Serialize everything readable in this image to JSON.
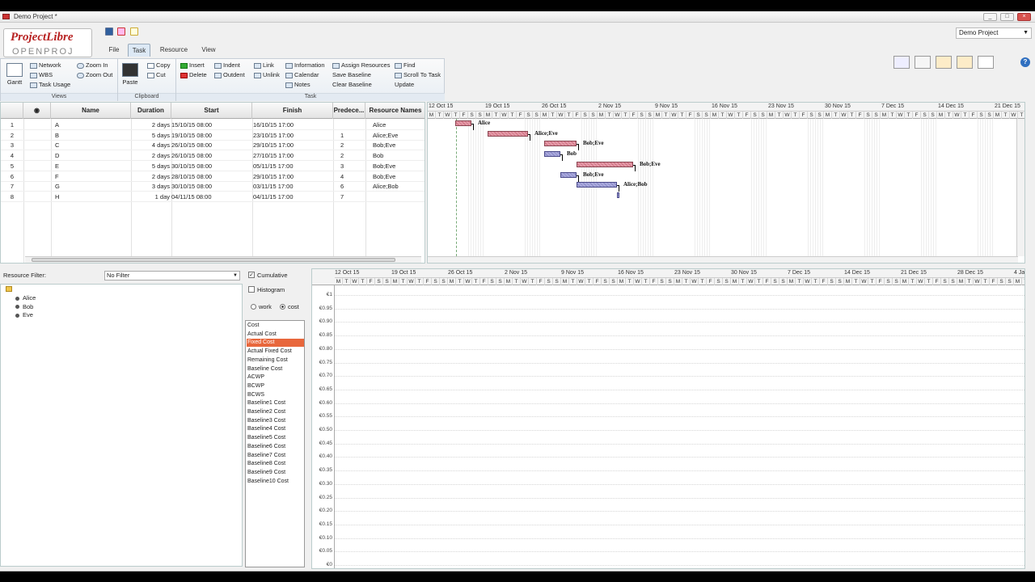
{
  "window": {
    "title": "Demo Project *"
  },
  "logo": {
    "line1": "ProjectLibre",
    "line2": "OPENPROJ"
  },
  "menu_tabs": [
    "File",
    "Task",
    "Resource",
    "View"
  ],
  "project_selector": {
    "value": "Demo Project"
  },
  "ribbon": {
    "views": {
      "label": "Views",
      "gantt": "Gantt",
      "network": "Network",
      "wbs": "WBS",
      "task_usage": "Task Usage",
      "zoom_in": "Zoom In",
      "zoom_out": "Zoom Out"
    },
    "clipboard": {
      "label": "Clipboard",
      "paste": "Paste",
      "copy": "Copy",
      "cut": "Cut"
    },
    "task": {
      "label": "Task",
      "insert": "Insert",
      "delete": "Delete",
      "indent": "Indent",
      "outdent": "Outdent",
      "link": "Link",
      "unlink": "Unlink",
      "information": "Information",
      "calendar": "Calendar",
      "notes": "Notes",
      "assign_resources": "Assign Resources",
      "save_baseline": "Save Baseline",
      "clear_baseline": "Clear Baseline",
      "find": "Find",
      "scroll_to_task": "Scroll To Task",
      "update": "Update"
    }
  },
  "task_table": {
    "headers": {
      "name": "Name",
      "duration": "Duration",
      "start": "Start",
      "finish": "Finish",
      "predecessors": "Predece...",
      "resource_names": "Resource Names"
    },
    "rows": [
      {
        "id": "1",
        "name": "A",
        "duration": "2 days",
        "start": "15/10/15 08:00",
        "finish": "16/10/15 17:00",
        "pred": "",
        "res": "Alice"
      },
      {
        "id": "2",
        "name": "B",
        "duration": "5 days",
        "start": "19/10/15 08:00",
        "finish": "23/10/15 17:00",
        "pred": "1",
        "res": "Alice;Eve"
      },
      {
        "id": "3",
        "name": "C",
        "duration": "4 days",
        "start": "26/10/15 08:00",
        "finish": "29/10/15 17:00",
        "pred": "2",
        "res": "Bob;Eve"
      },
      {
        "id": "4",
        "name": "D",
        "duration": "2 days",
        "start": "26/10/15 08:00",
        "finish": "27/10/15 17:00",
        "pred": "2",
        "res": "Bob"
      },
      {
        "id": "5",
        "name": "E",
        "duration": "5 days",
        "start": "30/10/15 08:00",
        "finish": "05/11/15 17:00",
        "pred": "3",
        "res": "Bob;Eve"
      },
      {
        "id": "6",
        "name": "F",
        "duration": "2 days",
        "start": "28/10/15 08:00",
        "finish": "29/10/15 17:00",
        "pred": "4",
        "res": "Bob;Eve"
      },
      {
        "id": "7",
        "name": "G",
        "duration": "3 days",
        "start": "30/10/15 08:00",
        "finish": "03/11/15 17:00",
        "pred": "6",
        "res": "Alice;Bob"
      },
      {
        "id": "8",
        "name": "H",
        "duration": "1 day",
        "start": "04/11/15 08:00",
        "finish": "04/11/15 17:00",
        "pred": "7",
        "res": ""
      }
    ]
  },
  "gantt": {
    "weeks": [
      "12 Oct 15",
      "19 Oct 15",
      "26 Oct 15",
      "2 Nov 15",
      "9 Nov 15",
      "16 Nov 15",
      "23 Nov 15",
      "30 Nov 15",
      "7 Dec 15",
      "14 Dec 15",
      "21 Dec 15"
    ],
    "day_letters": [
      "M",
      "T",
      "W",
      "T",
      "F",
      "S",
      "S"
    ],
    "bars": [
      {
        "task": "A",
        "start_day": 3,
        "dur": 2,
        "label": "Alice",
        "color": "red",
        "row": 0
      },
      {
        "task": "B",
        "start_day": 7,
        "dur": 5,
        "label": "Alice;Eve",
        "color": "red",
        "row": 1
      },
      {
        "task": "C",
        "start_day": 14,
        "dur": 4,
        "label": "Bob;Eve",
        "color": "red",
        "row": 2
      },
      {
        "task": "D",
        "start_day": 14,
        "dur": 2,
        "label": "Bob",
        "color": "blue",
        "row": 3
      },
      {
        "task": "E",
        "start_day": 18,
        "dur": 7,
        "label": "Bob;Eve",
        "color": "red",
        "row": 4
      },
      {
        "task": "F",
        "start_day": 16,
        "dur": 2,
        "label": "Bob;Eve",
        "color": "blue",
        "row": 5
      },
      {
        "task": "G",
        "start_day": 18,
        "dur": 5,
        "label": "Alice;Bob",
        "color": "blue",
        "row": 6
      },
      {
        "task": "H",
        "start_day": 23,
        "dur": 0.3,
        "label": "",
        "color": "blue",
        "row": 7
      }
    ]
  },
  "resource_filter": {
    "label": "Resource Filter:",
    "value": "No Filter"
  },
  "resources": [
    "Alice",
    "Bob",
    "Eve"
  ],
  "histogram_options": {
    "cumulative": "Cumulative",
    "histogram": "Histogram",
    "work": "work",
    "cost": "cost"
  },
  "cost_fields": [
    "Cost",
    "Actual Cost",
    "Fixed Cost",
    "Actual Fixed Cost",
    "Remaining Cost",
    "Baseline Cost",
    "ACWP",
    "BCWP",
    "BCWS",
    "Baseline1 Cost",
    "Baseline2 Cost",
    "Baseline3 Cost",
    "Baseline4 Cost",
    "Baseline5 Cost",
    "Baseline6 Cost",
    "Baseline7 Cost",
    "Baseline8 Cost",
    "Baseline9 Cost",
    "Baseline10 Cost"
  ],
  "cost_selected_index": 2,
  "usage_chart": {
    "weeks": [
      "12 Oct 15",
      "19 Oct 15",
      "26 Oct 15",
      "2 Nov 15",
      "9 Nov 15",
      "16 Nov 15",
      "23 Nov 15",
      "30 Nov 15",
      "7 Dec 15",
      "14 Dec 15",
      "21 Dec 15",
      "28 Dec 15",
      "4 Ja"
    ],
    "y_ticks": [
      "€1",
      "€0.95",
      "€0.90",
      "€0.85",
      "€0.80",
      "€0.75",
      "€0.70",
      "€0.65",
      "€0.60",
      "€0.55",
      "€0.50",
      "€0.45",
      "€0.40",
      "€0.35",
      "€0.30",
      "€0.25",
      "€0.20",
      "€0.15",
      "€0.10",
      "€0.05",
      "€0"
    ]
  }
}
